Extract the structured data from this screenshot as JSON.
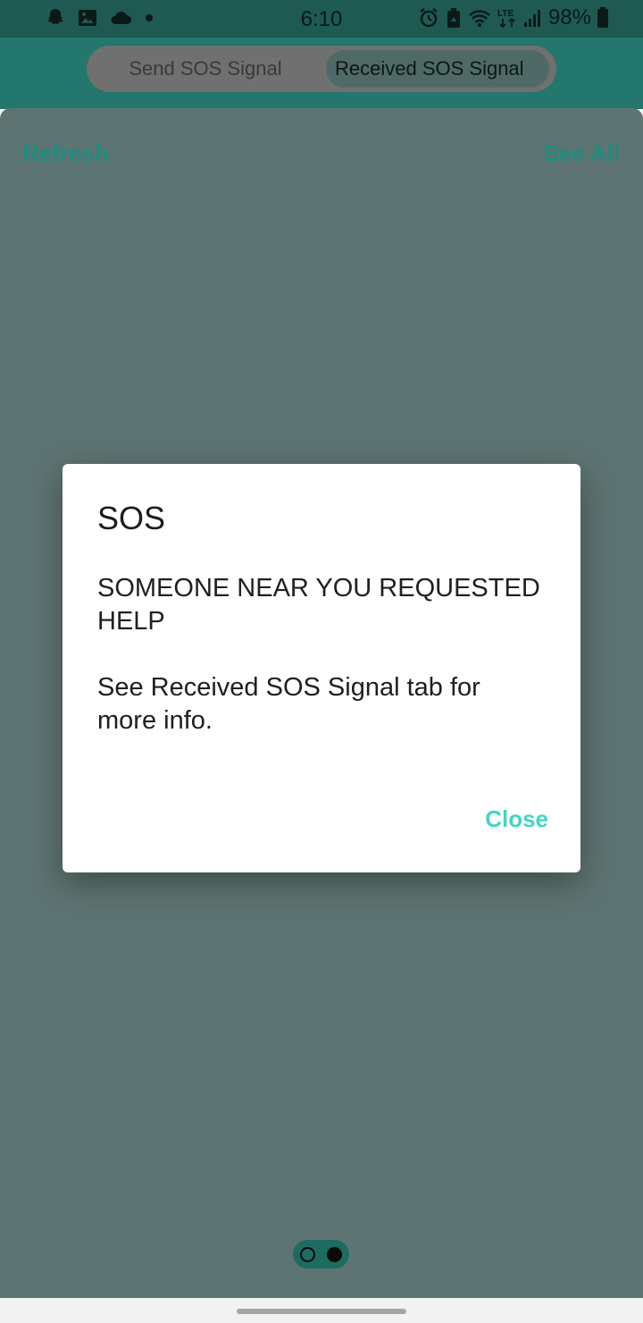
{
  "status_bar": {
    "time": "6:10",
    "battery": "98%",
    "network": "LTE",
    "left_icons": [
      "snapchat-icon",
      "gallery-icon",
      "cloud-icon",
      "notification-dot-icon"
    ],
    "right_icons": [
      "alarm-icon",
      "recycle-icon",
      "wifi-icon",
      "lte-icon",
      "signal-icon",
      "battery-icon"
    ]
  },
  "tabs": {
    "send": "Send SOS Signal",
    "received": "Received SOS Signal",
    "selected": "received"
  },
  "content": {
    "refresh": "Refresh",
    "see_all": "See All"
  },
  "pager": {
    "pages": 2,
    "current": 2
  },
  "dialog": {
    "title": "SOS",
    "message": "SOMEONE NEAR YOU REQUESTED HELP\n\nSee Received SOS Signal tab for more info.",
    "close": "Close"
  },
  "colors": {
    "accent": "#47d3c4",
    "header": "#23776c",
    "scrim_background": "#5e7472"
  }
}
